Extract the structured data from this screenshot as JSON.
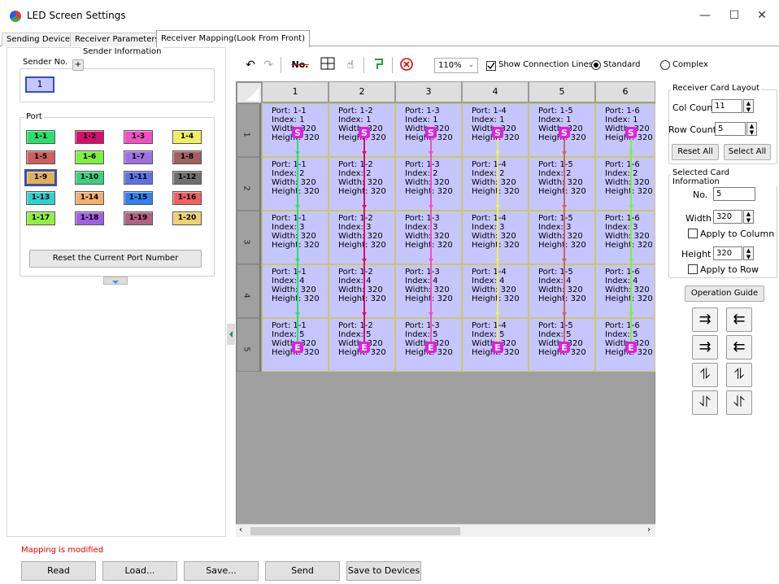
{
  "window": {
    "title": "LED Screen Settings",
    "min": "—",
    "max": "☐",
    "close": "✕"
  },
  "tabs": [
    "Sending Device",
    "Receiver Parameters",
    "Receiver Mapping(Look From Front)"
  ],
  "sender": {
    "group_title": "Sender Information",
    "label": "Sender No.",
    "add": "+",
    "value": "1"
  },
  "ports": {
    "group_title": "Port",
    "items": [
      {
        "label": "1-1",
        "color": "#29e06a"
      },
      {
        "label": "1-2",
        "color": "#d4106a"
      },
      {
        "label": "1-3",
        "color": "#f050c0"
      },
      {
        "label": "1-4",
        "color": "#f0ee60"
      },
      {
        "label": "1-5",
        "color": "#d06060"
      },
      {
        "label": "1-6",
        "color": "#7cf040"
      },
      {
        "label": "1-7",
        "color": "#a070e0"
      },
      {
        "label": "1-8",
        "color": "#a06060"
      },
      {
        "label": "1-9",
        "color": "#e0b060"
      },
      {
        "label": "1-10",
        "color": "#3ad080"
      },
      {
        "label": "1-11",
        "color": "#6070e0"
      },
      {
        "label": "1-12",
        "color": "#707070"
      },
      {
        "label": "1-13",
        "color": "#30d0d0"
      },
      {
        "label": "1-14",
        "color": "#f0b070"
      },
      {
        "label": "1-15",
        "color": "#3080f0"
      },
      {
        "label": "1-16",
        "color": "#f06060"
      },
      {
        "label": "1-17",
        "color": "#90f040"
      },
      {
        "label": "1-18",
        "color": "#a060e0"
      },
      {
        "label": "1-19",
        "color": "#b06080"
      },
      {
        "label": "1-20",
        "color": "#f0d070"
      }
    ],
    "reset_label": "Reset the Current Port Number"
  },
  "toolbar": {
    "zoom": "110%",
    "show_lines": "Show Connection Lines",
    "standard": "Standard",
    "complex": "Complex",
    "no_label": "No."
  },
  "grid": {
    "columns": [
      "1",
      "2",
      "3",
      "4",
      "5",
      "6"
    ],
    "rows": [
      "1",
      "2",
      "3",
      "4",
      "5"
    ],
    "cells": [
      [
        {
          "port": "Port: 1-1",
          "index": "Index: 1"
        },
        {
          "port": "Port: 1-2",
          "index": "Index: 1"
        },
        {
          "port": "Port: 1-3",
          "index": "Index: 1"
        },
        {
          "port": "Port: 1-4",
          "index": "Index: 1"
        },
        {
          "port": "Port: 1-5",
          "index": "Index: 1"
        },
        {
          "port": "Port: 1-6",
          "index": "Index: 1"
        }
      ],
      [
        {
          "port": "Port: 1-1",
          "index": "Index: 2"
        },
        {
          "port": "Port: 1-2",
          "index": "Index: 2"
        },
        {
          "port": "Port: 1-3",
          "index": "Index: 2"
        },
        {
          "port": "Port: 1-4",
          "index": "Index: 2"
        },
        {
          "port": "Port: 1-5",
          "index": "Index: 2"
        },
        {
          "port": "Port: 1-6",
          "index": "Index: 2"
        }
      ],
      [
        {
          "port": "Port: 1-1",
          "index": "Index: 3"
        },
        {
          "port": "Port: 1-2",
          "index": "Index: 3"
        },
        {
          "port": "Port: 1-3",
          "index": "Index: 3"
        },
        {
          "port": "Port: 1-4",
          "index": "Index: 3"
        },
        {
          "port": "Port: 1-5",
          "index": "Index: 3"
        },
        {
          "port": "Port: 1-6",
          "index": "Index: 3"
        }
      ],
      [
        {
          "port": "Port: 1-1",
          "index": "Index: 4"
        },
        {
          "port": "Port: 1-2",
          "index": "Index: 4"
        },
        {
          "port": "Port: 1-3",
          "index": "Index: 4"
        },
        {
          "port": "Port: 1-4",
          "index": "Index: 4"
        },
        {
          "port": "Port: 1-5",
          "index": "Index: 4"
        },
        {
          "port": "Port: 1-6",
          "index": "Index: 4"
        }
      ],
      [
        {
          "port": "Port: 1-1",
          "index": "Index: 5"
        },
        {
          "port": "Port: 1-2",
          "index": "Index: 5"
        },
        {
          "port": "Port: 1-3",
          "index": "Index: 5"
        },
        {
          "port": "Port: 1-4",
          "index": "Index: 5"
        },
        {
          "port": "Port: 1-5",
          "index": "Index: 5"
        },
        {
          "port": "Port: 1-6",
          "index": "Index: 5"
        }
      ]
    ],
    "width_text": "Width: 320",
    "height_text": "Height: 320",
    "start_marker": "S",
    "end_marker": "E",
    "line_colors": [
      "#29e06a",
      "#d4106a",
      "#f050c0",
      "#f0ee60",
      "#d06060",
      "#7cf040"
    ]
  },
  "layout_group": {
    "title": "Receiver Card Layout",
    "col_label": "Col Count",
    "col_value": "11",
    "row_label": "Row Count",
    "row_value": "5",
    "reset_all": "Reset All",
    "select_all": "Select All"
  },
  "selected_group": {
    "title": "Selected Card Information",
    "no_label": "No.",
    "no_value": "5",
    "width_label": "Width",
    "width_value": "320",
    "apply_col": "Apply to Column",
    "height_label": "Height",
    "height_value": "320",
    "apply_row": "Apply to Row"
  },
  "operation_guide": "Operation Guide",
  "status": "Mapping is modified",
  "bottom_buttons": [
    "Read",
    "Load...",
    "Save...",
    "Send",
    "Save to Devices"
  ]
}
